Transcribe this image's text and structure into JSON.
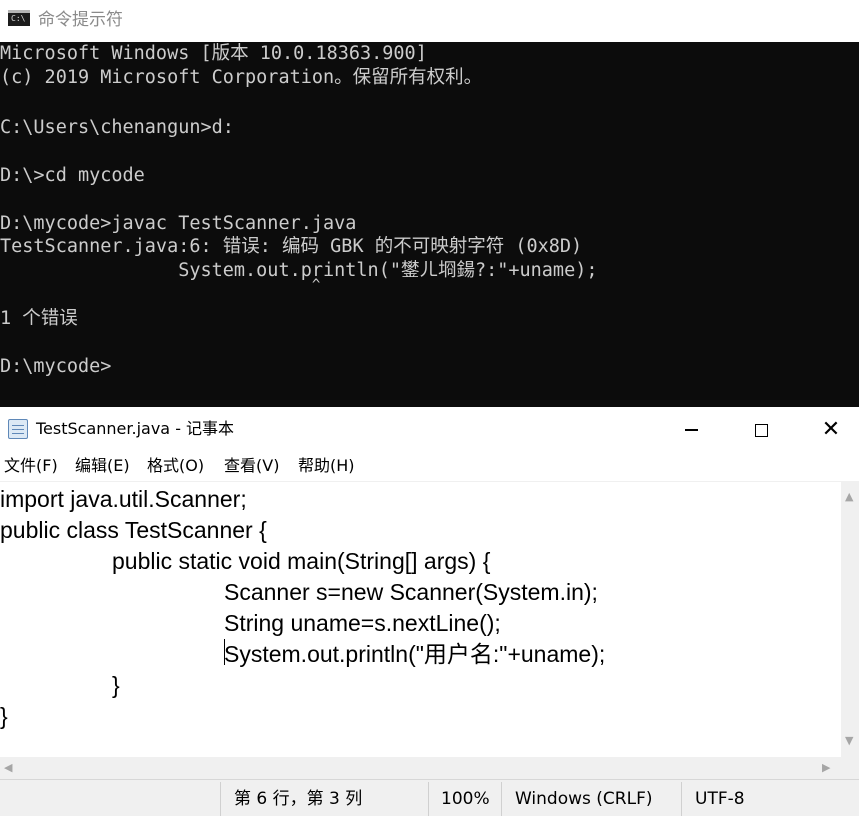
{
  "cmd": {
    "title": "命令提示符",
    "icon_text": "C:\\",
    "lines": [
      "Microsoft Windows [版本 10.0.18363.900]",
      "(c) 2019 Microsoft Corporation。保留所有权利。",
      "",
      "C:\\Users\\chenangun>d:",
      "",
      "D:\\>cd mycode",
      "",
      "D:\\mycode>javac TestScanner.java",
      "TestScanner.java:6: 错误: 编码 GBK 的不可映射字符 (0x8D)",
      "                System.out.println(\"鐢ㄦ埛鍚?:\"+uname);",
      "                                     ^",
      "1 个错误",
      "",
      "D:\\mycode>"
    ]
  },
  "notepad": {
    "title": "TestScanner.java - 记事本",
    "window_buttons": {
      "minimize": "—",
      "close": "✕"
    },
    "menu": [
      "文件(F)",
      "编辑(E)",
      "格式(O)",
      "查看(V)",
      "帮助(H)"
    ],
    "code_lines": [
      "import java.util.Scanner;",
      "public class TestScanner {",
      "\tpublic static void main(String[] args) {",
      "\t\tScanner s=new Scanner(System.in);",
      "\t\tString uname=s.nextLine();",
      "\t\tSystem.out.println(\"用户名:\"+uname);",
      "\t}",
      "}"
    ],
    "scroll_arrows": {
      "up": "▲",
      "down": "▼",
      "left": "◀",
      "right": "▶"
    },
    "status": {
      "position": "第 6 行，第 3 列",
      "zoom": "100%",
      "line_ending": "Windows (CRLF)",
      "encoding": "UTF-8"
    }
  }
}
